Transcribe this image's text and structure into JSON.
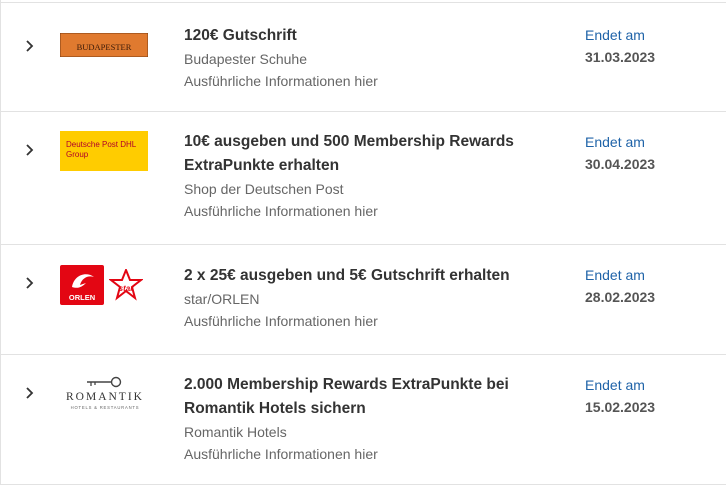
{
  "offers": [
    {
      "title": "120€ Gutschrift",
      "merchant": "Budapester Schuhe",
      "info_link": "Ausführliche Informationen hier",
      "ends_label": "Endet am",
      "ends_date": "31.03.2023",
      "logo_text": "BUDAPESTER"
    },
    {
      "title": "10€ ausgeben und 500 Membership Rewards ExtraPunkte erhalten",
      "merchant": "Shop der Deutschen Post",
      "info_link": "Ausführliche Informationen hier",
      "ends_label": "Endet am",
      "ends_date": "30.04.2023",
      "logo_text_1": "Deutsche Post DHL",
      "logo_text_2": "Group"
    },
    {
      "title": "2 x 25€ ausgeben und 5€ Gutschrift erhalten",
      "merchant": "star/ORLEN",
      "info_link": "Ausführliche Informationen hier",
      "ends_label": "Endet am",
      "ends_date": "28.02.2023",
      "logo_text_orlen": "ORLEN",
      "logo_text_star": "star"
    },
    {
      "title": "2.000 Membership Rewards ExtraPunkte bei Romantik Hotels sichern",
      "merchant": "Romantik Hotels",
      "info_link": "Ausführliche Informationen hier",
      "ends_label": "Endet am",
      "ends_date": "15.02.2023",
      "logo_text": "ROMANTIK",
      "logo_subtext": "HOTELS & RESTAURANTS"
    }
  ],
  "colors": {
    "link": "#1f63a8",
    "budapester_bg": "#e07a2f",
    "dhl_bg": "#ffcc00",
    "orlen_red": "#e30613"
  },
  "icons": [
    "chevron-right-icon",
    "budapester-logo",
    "deutsche-post-dhl-logo",
    "orlen-logo",
    "star-logo",
    "romantik-logo"
  ]
}
